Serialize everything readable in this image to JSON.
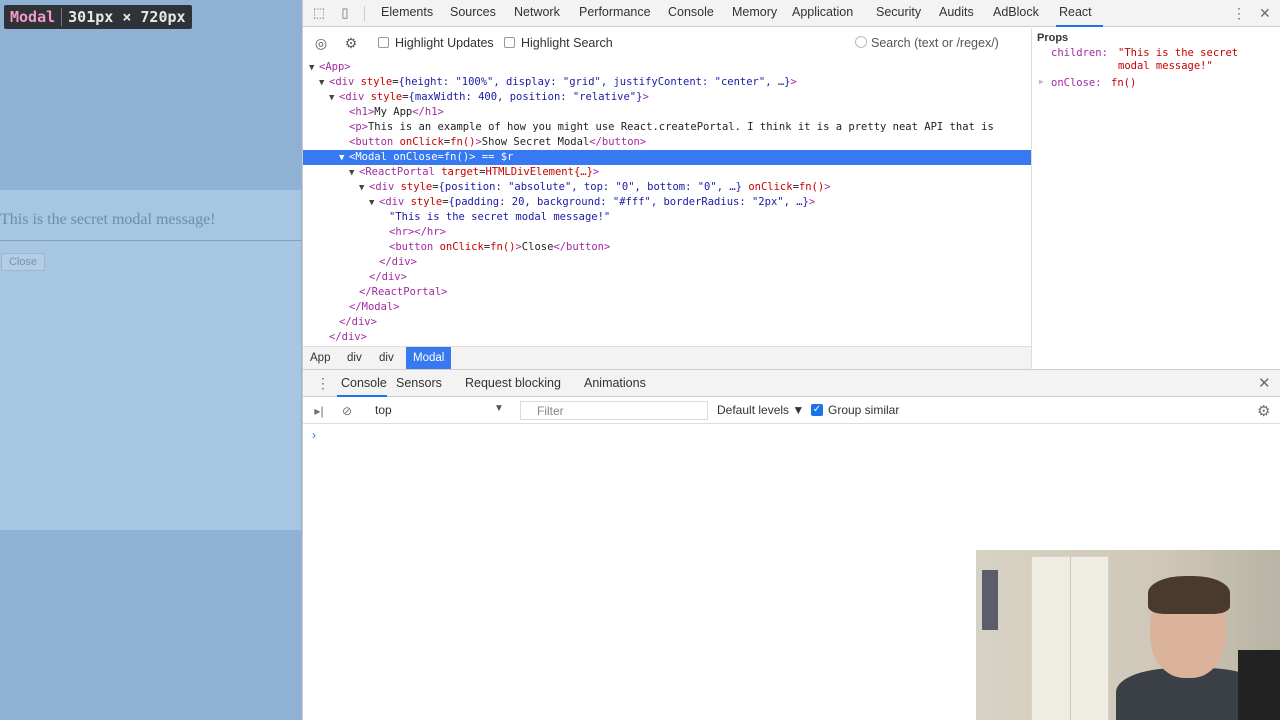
{
  "preview": {
    "badge_name": "Modal",
    "badge_dims": "301px × 720px",
    "modal_message": "This is the secret modal message!",
    "close_label": "Close"
  },
  "devtools": {
    "tabs": [
      "Elements",
      "Sources",
      "Network",
      "Performance",
      "Console",
      "Memory",
      "Application",
      "Security",
      "Audits",
      "AdBlock",
      "React"
    ],
    "active_tab": "React"
  },
  "react_toolbar": {
    "highlight_updates": "Highlight Updates",
    "highlight_search": "Highlight Search",
    "search_placeholder": "Search (text or /regex/)"
  },
  "tree": [
    {
      "indent": 0,
      "arrow": "▼",
      "parts": [
        [
          "t-tag",
          "<App>"
        ]
      ]
    },
    {
      "indent": 1,
      "arrow": "▼",
      "parts": [
        [
          "t-tag",
          "<div "
        ],
        [
          "t-attr",
          "style"
        ],
        [
          "t-text",
          "="
        ],
        [
          "t-str",
          "{height: \"100%\", display: \"grid\", justifyContent: \"center\", …}"
        ],
        [
          "t-tag",
          ">"
        ]
      ]
    },
    {
      "indent": 2,
      "arrow": "▼",
      "parts": [
        [
          "t-tag",
          "<div "
        ],
        [
          "t-attr",
          "style"
        ],
        [
          "t-text",
          "="
        ],
        [
          "t-str",
          "{maxWidth: 400, position: \"relative\"}"
        ],
        [
          "t-tag",
          ">"
        ]
      ]
    },
    {
      "indent": 3,
      "arrow": "",
      "parts": [
        [
          "t-tag",
          "<h1>"
        ],
        [
          "t-text",
          "My App"
        ],
        [
          "t-tag",
          "</h1>"
        ]
      ]
    },
    {
      "indent": 3,
      "arrow": "",
      "parts": [
        [
          "t-tag",
          "<p>"
        ],
        [
          "t-text",
          "This is an example of how you might use React.createPortal. I think it is a pretty neat API that is"
        ]
      ]
    },
    {
      "indent": 3,
      "arrow": "",
      "parts": [
        [
          "t-tag",
          "<button "
        ],
        [
          "t-attr",
          "onClick"
        ],
        [
          "t-text",
          "="
        ],
        [
          "t-fn",
          "fn()"
        ],
        [
          "t-tag",
          ">"
        ],
        [
          "t-text",
          "Show Secret Modal"
        ],
        [
          "t-tag",
          "</button>"
        ]
      ]
    },
    {
      "indent": 3,
      "arrow": "▼",
      "selected": true,
      "parts": [
        [
          "t-tag",
          "<Modal "
        ],
        [
          "t-attr",
          "onClose"
        ],
        [
          "t-text",
          "=fn()"
        ],
        [
          "t-tag",
          ">"
        ],
        [
          "t-text",
          " == $r"
        ]
      ]
    },
    {
      "indent": 4,
      "arrow": "▼",
      "parts": [
        [
          "t-tag",
          "<ReactPortal "
        ],
        [
          "t-attr",
          "target"
        ],
        [
          "t-text",
          "="
        ],
        [
          "t-fn",
          "HTMLDivElement{…}"
        ],
        [
          "t-tag",
          ">"
        ]
      ]
    },
    {
      "indent": 5,
      "arrow": "▼",
      "parts": [
        [
          "t-tag",
          "<div "
        ],
        [
          "t-attr",
          "style"
        ],
        [
          "t-text",
          "="
        ],
        [
          "t-str",
          "{position: \"absolute\", top: \"0\", bottom: \"0\", …}"
        ],
        [
          "t-text",
          " "
        ],
        [
          "t-attr",
          "onClick"
        ],
        [
          "t-text",
          "="
        ],
        [
          "t-fn",
          "fn()"
        ],
        [
          "t-tag",
          ">"
        ]
      ]
    },
    {
      "indent": 6,
      "arrow": "▼",
      "parts": [
        [
          "t-tag",
          "<div "
        ],
        [
          "t-attr",
          "style"
        ],
        [
          "t-text",
          "="
        ],
        [
          "t-str",
          "{padding: 20, background: \"#fff\", borderRadius: \"2px\", …}"
        ],
        [
          "t-tag",
          ">"
        ]
      ]
    },
    {
      "indent": 7,
      "arrow": "",
      "parts": [
        [
          "t-str",
          "\"This is the secret modal message!\""
        ]
      ]
    },
    {
      "indent": 7,
      "arrow": "",
      "parts": [
        [
          "t-tag",
          "<hr></hr>"
        ]
      ]
    },
    {
      "indent": 7,
      "arrow": "",
      "parts": [
        [
          "t-tag",
          "<button "
        ],
        [
          "t-attr",
          "onClick"
        ],
        [
          "t-text",
          "="
        ],
        [
          "t-fn",
          "fn()"
        ],
        [
          "t-tag",
          ">"
        ],
        [
          "t-text",
          "Close"
        ],
        [
          "t-tag",
          "</button>"
        ]
      ]
    },
    {
      "indent": 6,
      "arrow": "",
      "parts": [
        [
          "t-tag",
          "</div>"
        ]
      ]
    },
    {
      "indent": 5,
      "arrow": "",
      "parts": [
        [
          "t-tag",
          "</div>"
        ]
      ]
    },
    {
      "indent": 4,
      "arrow": "",
      "parts": [
        [
          "t-tag",
          "</ReactPortal>"
        ]
      ]
    },
    {
      "indent": 3,
      "arrow": "",
      "parts": [
        [
          "t-tag",
          "</Modal>"
        ]
      ]
    },
    {
      "indent": 2,
      "arrow": "",
      "parts": [
        [
          "t-tag",
          "</div>"
        ]
      ]
    },
    {
      "indent": 1,
      "arrow": "",
      "parts": [
        [
          "t-tag",
          "</div>"
        ]
      ]
    }
  ],
  "breadcrumb": [
    "App",
    "div",
    "div",
    "Modal"
  ],
  "props": {
    "title": "Props",
    "children_key": "children:",
    "children_val_1": "\"This is the secret",
    "children_val_2": "modal message!\"",
    "onclose_key": "onClose:",
    "onclose_val": "fn()"
  },
  "drawer": {
    "tabs": [
      "Console",
      "Sensors",
      "Request blocking",
      "Animations"
    ],
    "context": "top",
    "filter_placeholder": "Filter",
    "levels": "Default levels ▼",
    "group_similar": "Group similar",
    "prompt": "›"
  },
  "colors": {
    "accent": "#1a73e8",
    "selection": "#3679f0",
    "preview_bg": "#8fb1d4"
  }
}
